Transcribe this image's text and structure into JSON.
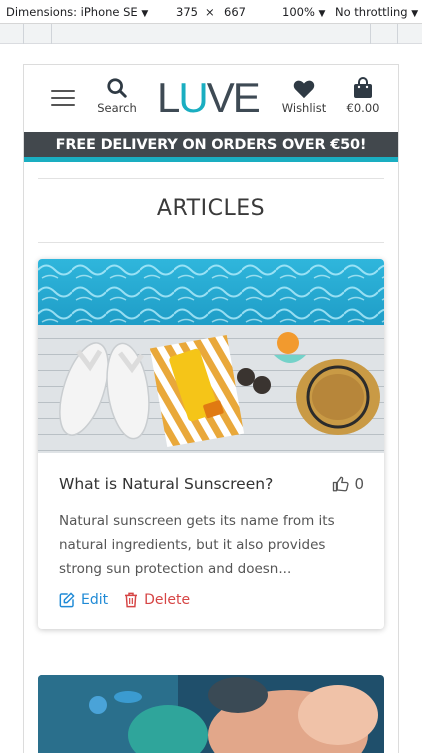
{
  "devtools": {
    "dimensions_label": "Dimensions: iPhone SE",
    "width": "375",
    "times": "×",
    "height": "667",
    "zoom": "100%",
    "throttling": "No throttling"
  },
  "header": {
    "search_label": "Search",
    "logo": {
      "part1": "L",
      "part2": "U",
      "part3": "VE"
    },
    "wishlist_label": "Wishlist",
    "bag_total": "€0.00"
  },
  "banner": {
    "text": "FREE DELIVERY ON ORDERS OVER €50!"
  },
  "page": {
    "title": "ARTICLES"
  },
  "articles": [
    {
      "title": "What is Natural Sunscreen?",
      "likes": "0",
      "excerpt": "Natural sunscreen gets its name from its natural ingredients, but it also provides strong sun protection and doesn...",
      "edit_label": "Edit",
      "delete_label": "Delete"
    }
  ],
  "colors": {
    "brand_teal": "#1aaec1",
    "banner_bg": "#42484d",
    "edit_blue": "#1f8ad6",
    "delete_red": "#d64545"
  },
  "icons": [
    "menu-icon",
    "search-icon",
    "heart-icon",
    "shopping-bag-icon",
    "thumbs-up-icon",
    "edit-icon",
    "trash-icon"
  ]
}
